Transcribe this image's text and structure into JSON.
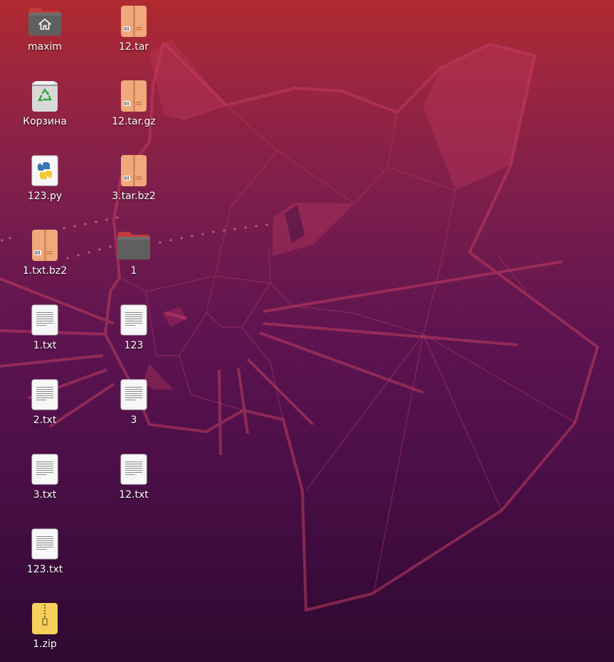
{
  "colors": {
    "archive_body": "#efa97a",
    "archive_dark": "#d9875a",
    "folder_body": "#5f5f5f",
    "folder_tab": "#c33a3a",
    "text_doc": "#f7f7f7",
    "zip_body": "#f6d05a",
    "python_blue": "#3b74b0",
    "python_yellow": "#f4c92f",
    "trash_green": "#2e9e3e"
  },
  "desktop": {
    "icons": [
      {
        "name": "maxim",
        "kind": "home-folder"
      },
      {
        "name": "Корзина",
        "kind": "trash"
      },
      {
        "name": "123.py",
        "kind": "python"
      },
      {
        "name": "1.txt.bz2",
        "kind": "archive"
      },
      {
        "name": "1.txt",
        "kind": "text"
      },
      {
        "name": "2.txt",
        "kind": "text"
      },
      {
        "name": "3.txt",
        "kind": "text"
      },
      {
        "name": "123.txt",
        "kind": "text"
      },
      {
        "name": "1.zip",
        "kind": "zip"
      },
      {
        "name": "12.tar",
        "kind": "archive"
      },
      {
        "name": "12.tar.gz",
        "kind": "archive"
      },
      {
        "name": "3.tar.bz2",
        "kind": "archive"
      },
      {
        "name": "1",
        "kind": "folder"
      },
      {
        "name": "123",
        "kind": "text"
      },
      {
        "name": "3",
        "kind": "text"
      },
      {
        "name": "12.txt",
        "kind": "text"
      }
    ]
  }
}
